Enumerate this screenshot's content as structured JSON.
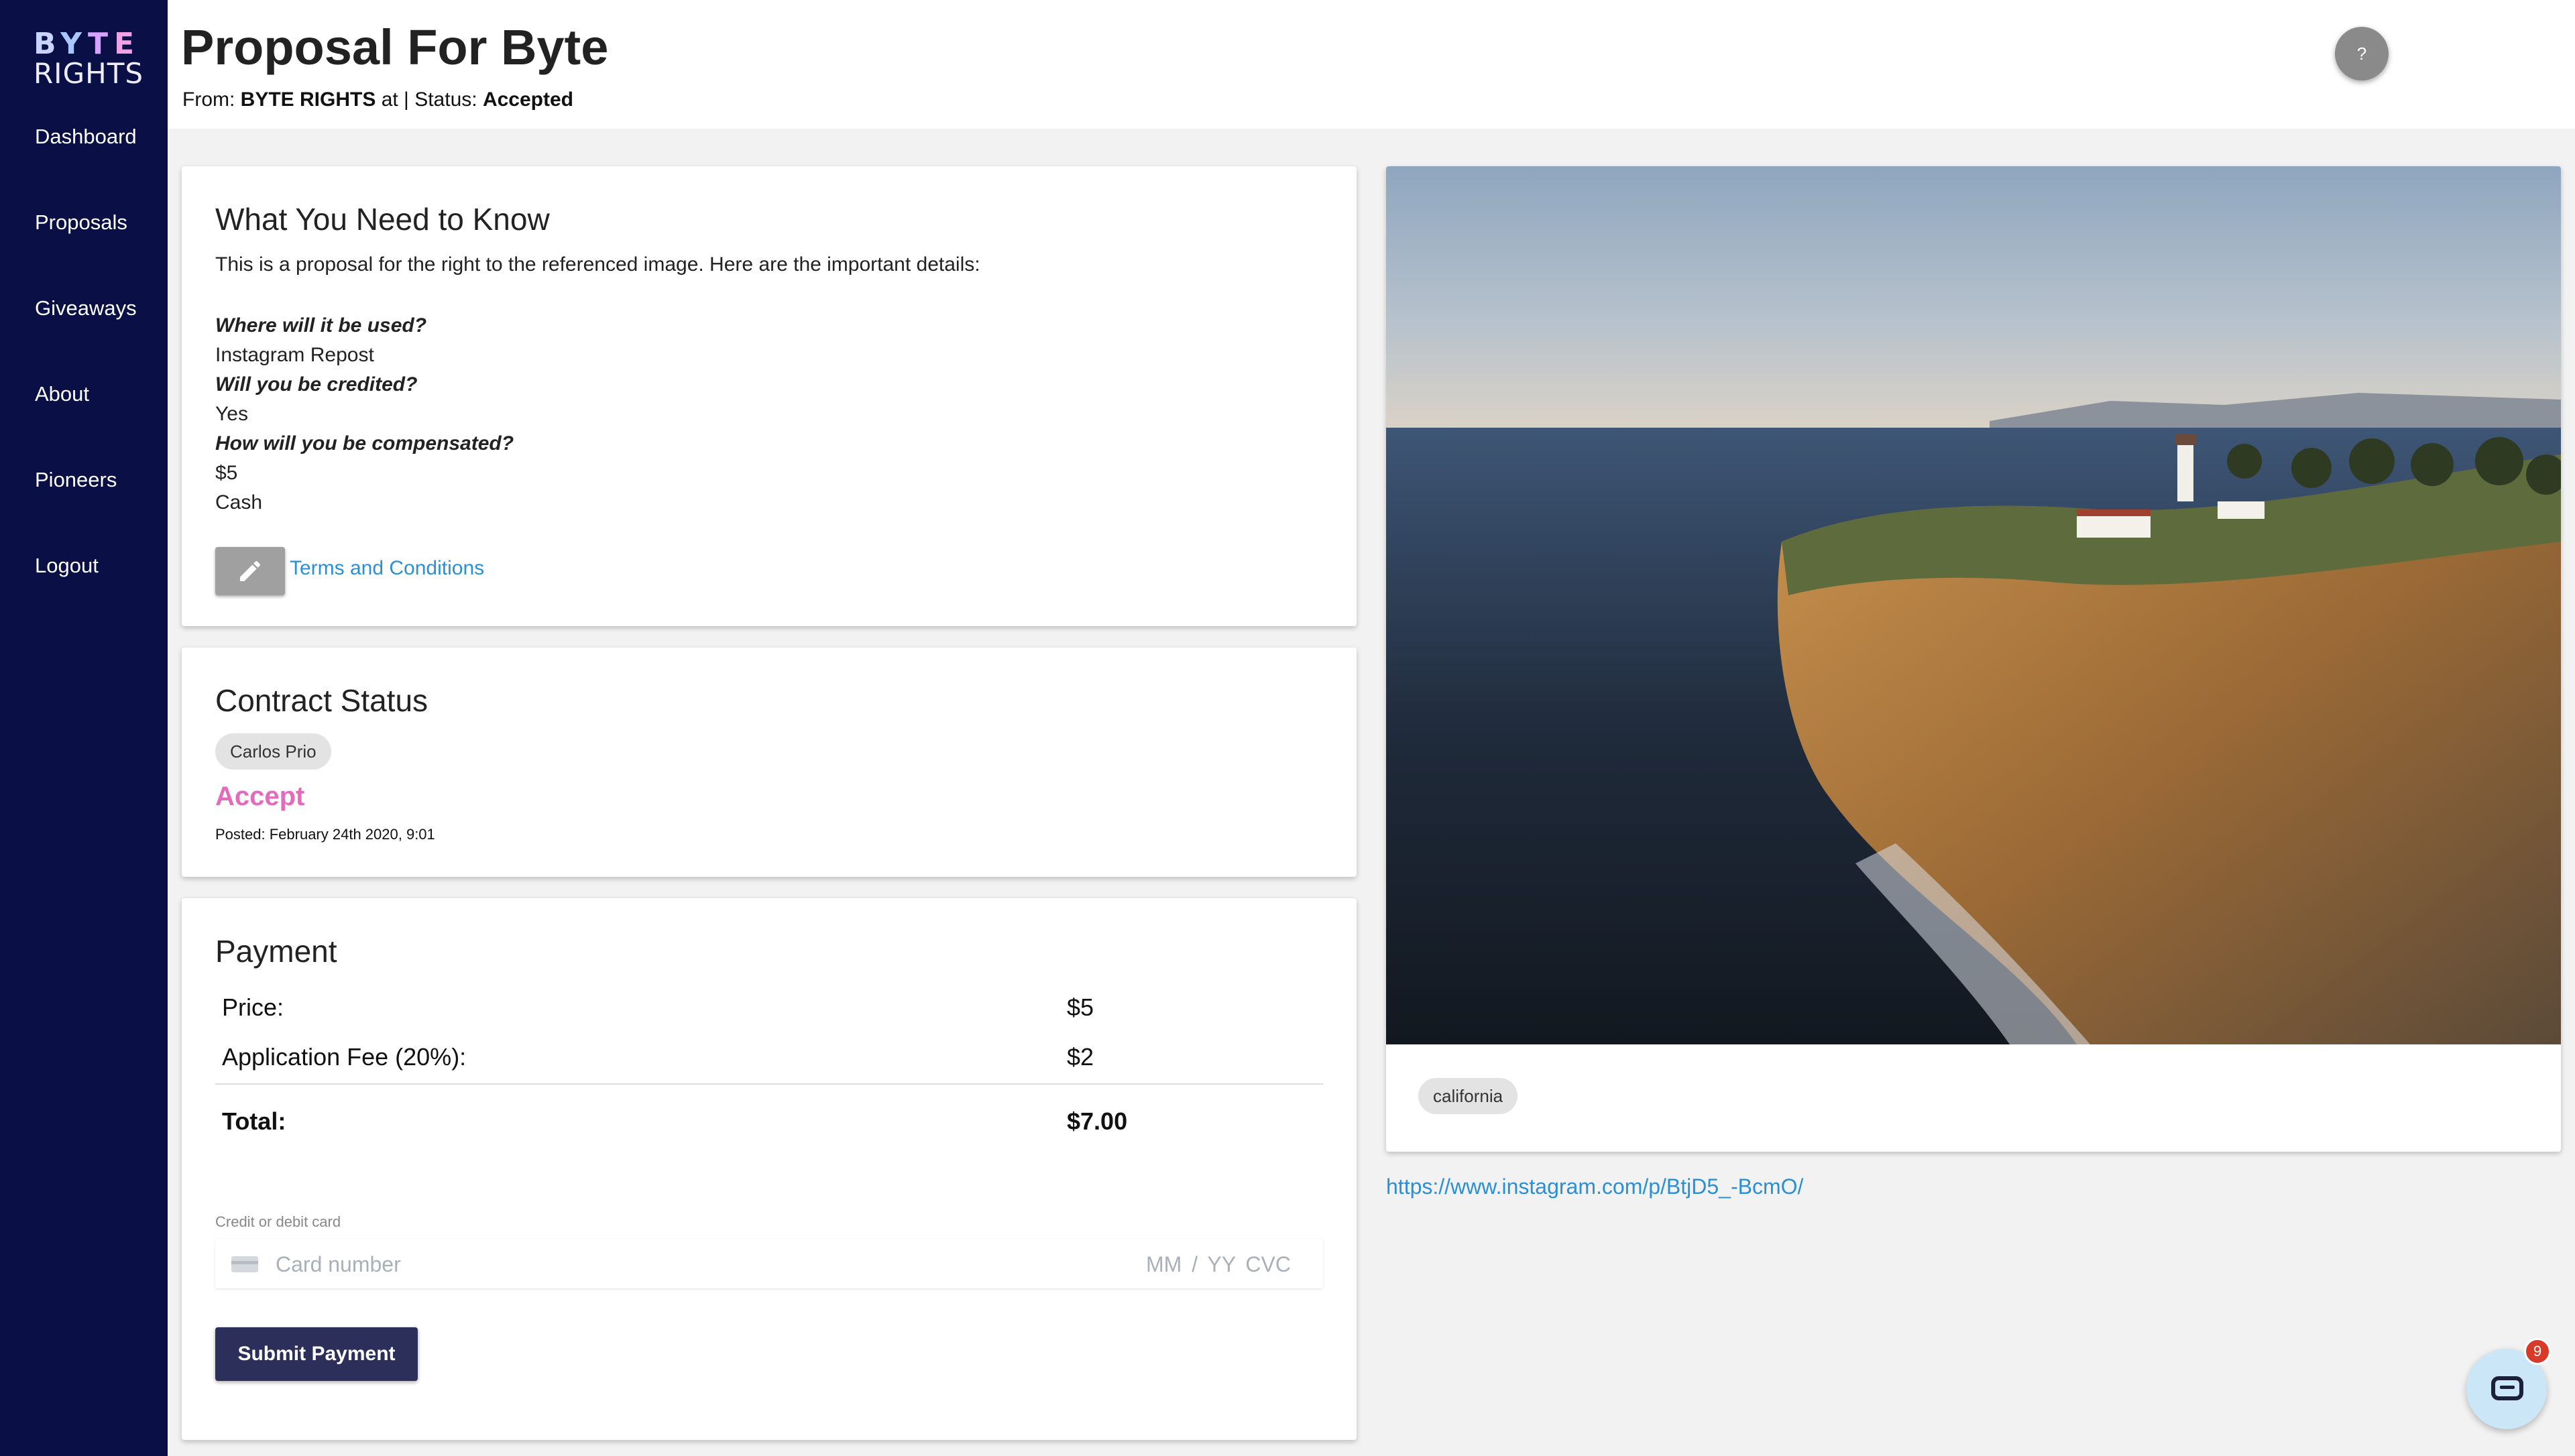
{
  "sidebar": {
    "logo_top": "BYTE",
    "logo_bottom": "RIGHTS",
    "items": [
      {
        "label": "Dashboard"
      },
      {
        "label": "Proposals"
      },
      {
        "label": "Giveaways"
      },
      {
        "label": "About"
      },
      {
        "label": "Pioneers"
      },
      {
        "label": "Logout"
      }
    ]
  },
  "header": {
    "title": "Proposal For Byte",
    "from_label": "From:",
    "from_value": "BYTE RIGHTS",
    "at_text": "at |",
    "status_label": "Status:",
    "status_value": "Accepted",
    "help_label": "?"
  },
  "know": {
    "title": "What You Need to Know",
    "intro": "This is a proposal for the right to the referenced image. Here are the important details:",
    "used_q": "Where will it be used?",
    "used_a": "Instagram Repost",
    "credited_q": "Will you be credited?",
    "credited_a": "Yes",
    "comp_q": "How will you be compensated?",
    "comp_amount": "$5",
    "comp_type": "Cash",
    "edit_icon": "pencil-icon",
    "terms_link": "Terms and Conditions"
  },
  "contract": {
    "title": "Contract Status",
    "party": "Carlos Prio",
    "decision": "Accept",
    "posted": "Posted: February 24th 2020, 9:01"
  },
  "payment": {
    "title": "Payment",
    "price_label": "Price:",
    "price_value": "$5",
    "fee_label": "Application Fee (20%):",
    "fee_value": "$2",
    "total_label": "Total:",
    "total_value": "$7.00",
    "card_label": "Credit or debit card",
    "card_placeholder": "Card number",
    "expiry_cvc_placeholder": "MM / YY  CVC",
    "submit_label": "Submit Payment"
  },
  "image": {
    "tag": "california",
    "link": "https://www.instagram.com/p/BtjD5_-BcmO/"
  },
  "chat": {
    "badge_count": "9",
    "icon": "chat-icon"
  }
}
